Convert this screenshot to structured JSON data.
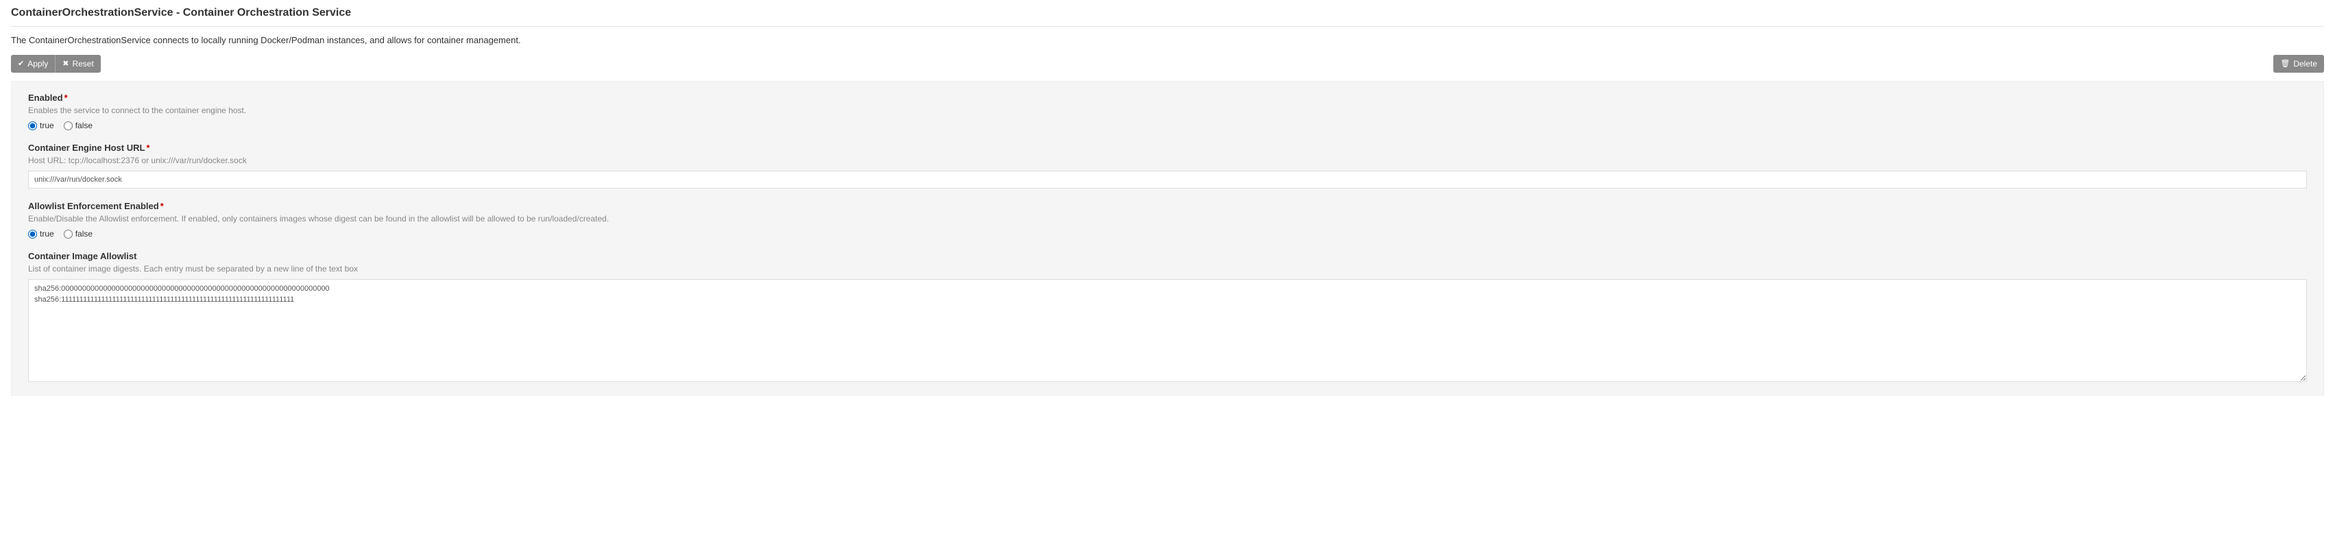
{
  "page": {
    "title": "ContainerOrchestrationService - Container Orchestration Service",
    "description": "The ContainerOrchestrationService connects to locally running Docker/Podman instances, and allows for container management."
  },
  "toolbar": {
    "apply_label": "Apply",
    "reset_label": "Reset",
    "delete_label": "Delete"
  },
  "fields": {
    "enabled": {
      "label": "Enabled",
      "help": "Enables the service to connect to the container engine host.",
      "true_label": "true",
      "false_label": "false",
      "value": "true"
    },
    "host_url": {
      "label": "Container Engine Host URL",
      "help": "Host URL: tcp://localhost:2376 or unix:///var/run/docker.sock",
      "value": "unix:///var/run/docker.sock"
    },
    "allowlist_enabled": {
      "label": "Allowlist Enforcement Enabled",
      "help": "Enable/Disable the Allowlist enforcement. If enabled, only containers images whose digest can be found in the allowlist will be allowed to be run/loaded/created.",
      "true_label": "true",
      "false_label": "false",
      "value": "true"
    },
    "allowlist": {
      "label": "Container Image Allowlist",
      "help": "List of container image digests. Each entry must be separated by a new line of the text box",
      "value": "sha256:0000000000000000000000000000000000000000000000000000000000000000\nsha256:1111111111111111111111111111111111111111111111111111111111111111"
    }
  }
}
